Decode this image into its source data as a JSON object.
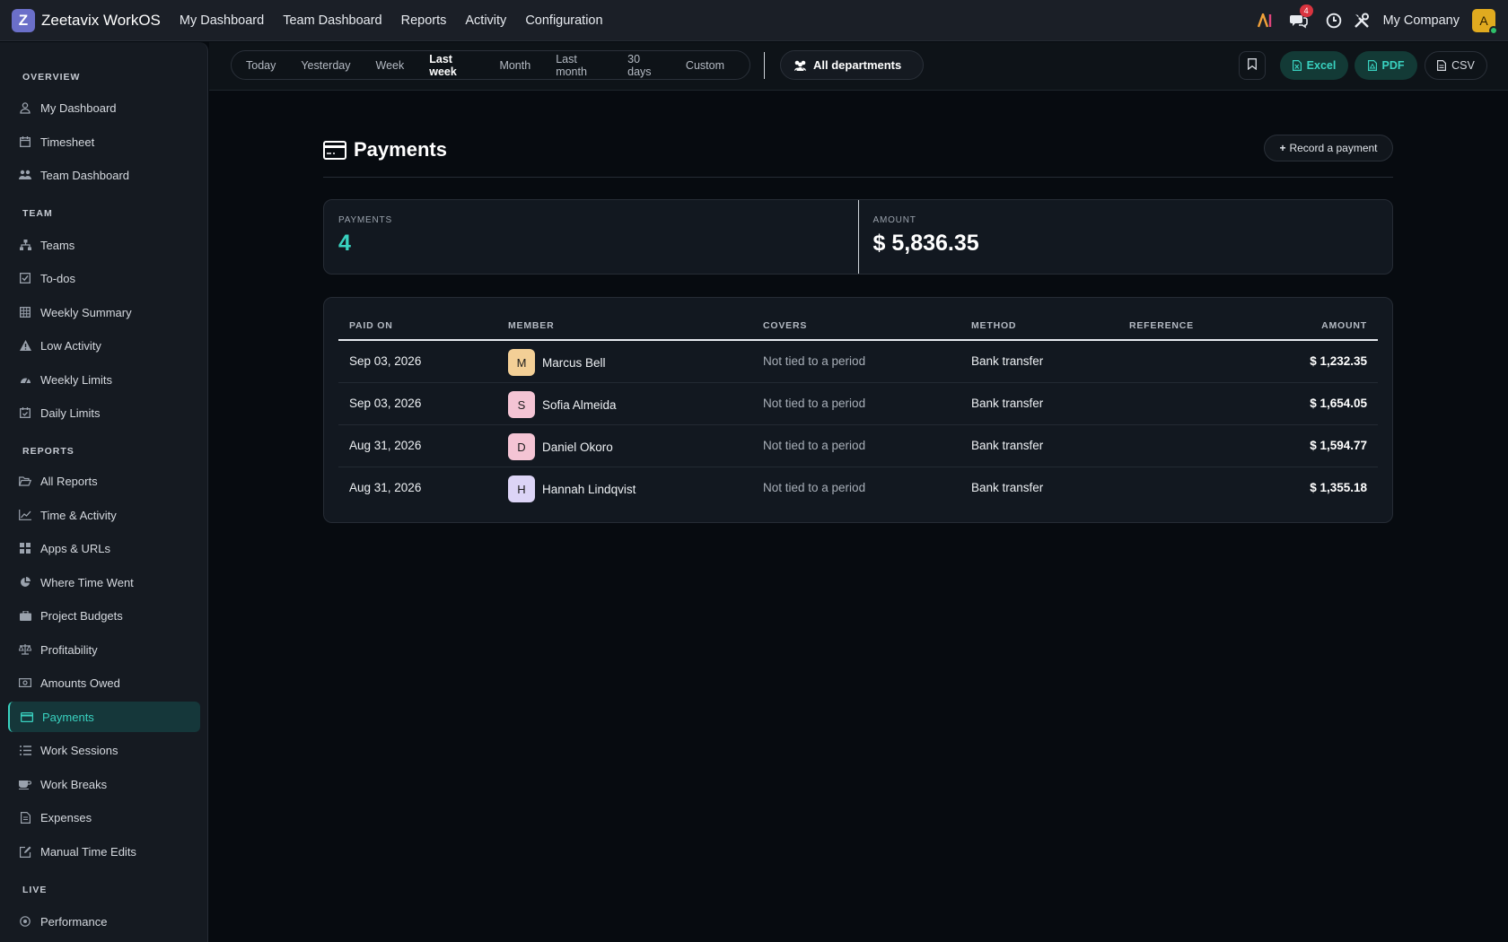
{
  "app": {
    "logo_letter": "Z",
    "name": "Zeetavix WorkOS"
  },
  "topnav": [
    "My Dashboard",
    "Team Dashboard",
    "Reports",
    "Activity",
    "Configuration"
  ],
  "topbar": {
    "ai_label": "AI",
    "chat_count": "4",
    "company": "My Company",
    "avatar_letter": "A"
  },
  "sidebar": {
    "sections": {
      "overview": "OVERVIEW",
      "team": "TEAM",
      "reports": "REPORTS",
      "live": "LIVE"
    },
    "items": [
      "My Dashboard",
      "Timesheet",
      "Team Dashboard",
      "Teams",
      "To-dos",
      "Weekly Summary",
      "Low Activity",
      "Weekly Limits",
      "Daily Limits",
      "All Reports",
      "Time & Activity",
      "Apps & URLs",
      "Where Time Went",
      "Project Budgets",
      "Profitability",
      "Amounts Owed",
      "Payments",
      "Work Sessions",
      "Work Breaks",
      "Expenses",
      "Manual Time Edits",
      "Performance"
    ],
    "active": "Payments"
  },
  "toolbar": {
    "ranges": [
      "Today",
      "Yesterday",
      "Week",
      "Last week",
      "Month",
      "Last month",
      "30 days",
      "Custom"
    ],
    "selected_range": "Last week",
    "department": "All departments",
    "excel": "Excel",
    "pdf": "PDF",
    "csv": "CSV"
  },
  "page": {
    "title": "Payments",
    "record_button": "Record a payment"
  },
  "stats": {
    "payments_label": "PAYMENTS",
    "payments_value": "4",
    "amount_label": "AMOUNT",
    "amount_value": "$ 5,836.35"
  },
  "table": {
    "headers": {
      "paid_on": "PAID ON",
      "member": "MEMBER",
      "covers": "COVERS",
      "method": "METHOD",
      "reference": "REFERENCE",
      "amount": "AMOUNT"
    },
    "rows": [
      {
        "paid_on": "Sep 03, 2026",
        "initial": "M",
        "avatar_color": "#f3cf96",
        "member": "Marcus Bell",
        "covers": "Not tied to a period",
        "method": "Bank transfer",
        "reference": "",
        "amount": "$ 1,232.35"
      },
      {
        "paid_on": "Sep 03, 2026",
        "initial": "S",
        "avatar_color": "#f4c4d4",
        "member": "Sofia Almeida",
        "covers": "Not tied to a period",
        "method": "Bank transfer",
        "reference": "",
        "amount": "$ 1,654.05"
      },
      {
        "paid_on": "Aug 31, 2026",
        "initial": "D",
        "avatar_color": "#f4c4d4",
        "member": "Daniel Okoro",
        "covers": "Not tied to a period",
        "method": "Bank transfer",
        "reference": "",
        "amount": "$ 1,594.77"
      },
      {
        "paid_on": "Aug 31, 2026",
        "initial": "H",
        "avatar_color": "#dcd4f6",
        "member": "Hannah Lindqvist",
        "covers": "Not tied to a period",
        "method": "Bank transfer",
        "reference": "",
        "amount": "$ 1,355.18"
      }
    ]
  },
  "colors": {
    "accent": "#39d2c0",
    "topbar": "#1b1f27",
    "background": "#070b10"
  }
}
